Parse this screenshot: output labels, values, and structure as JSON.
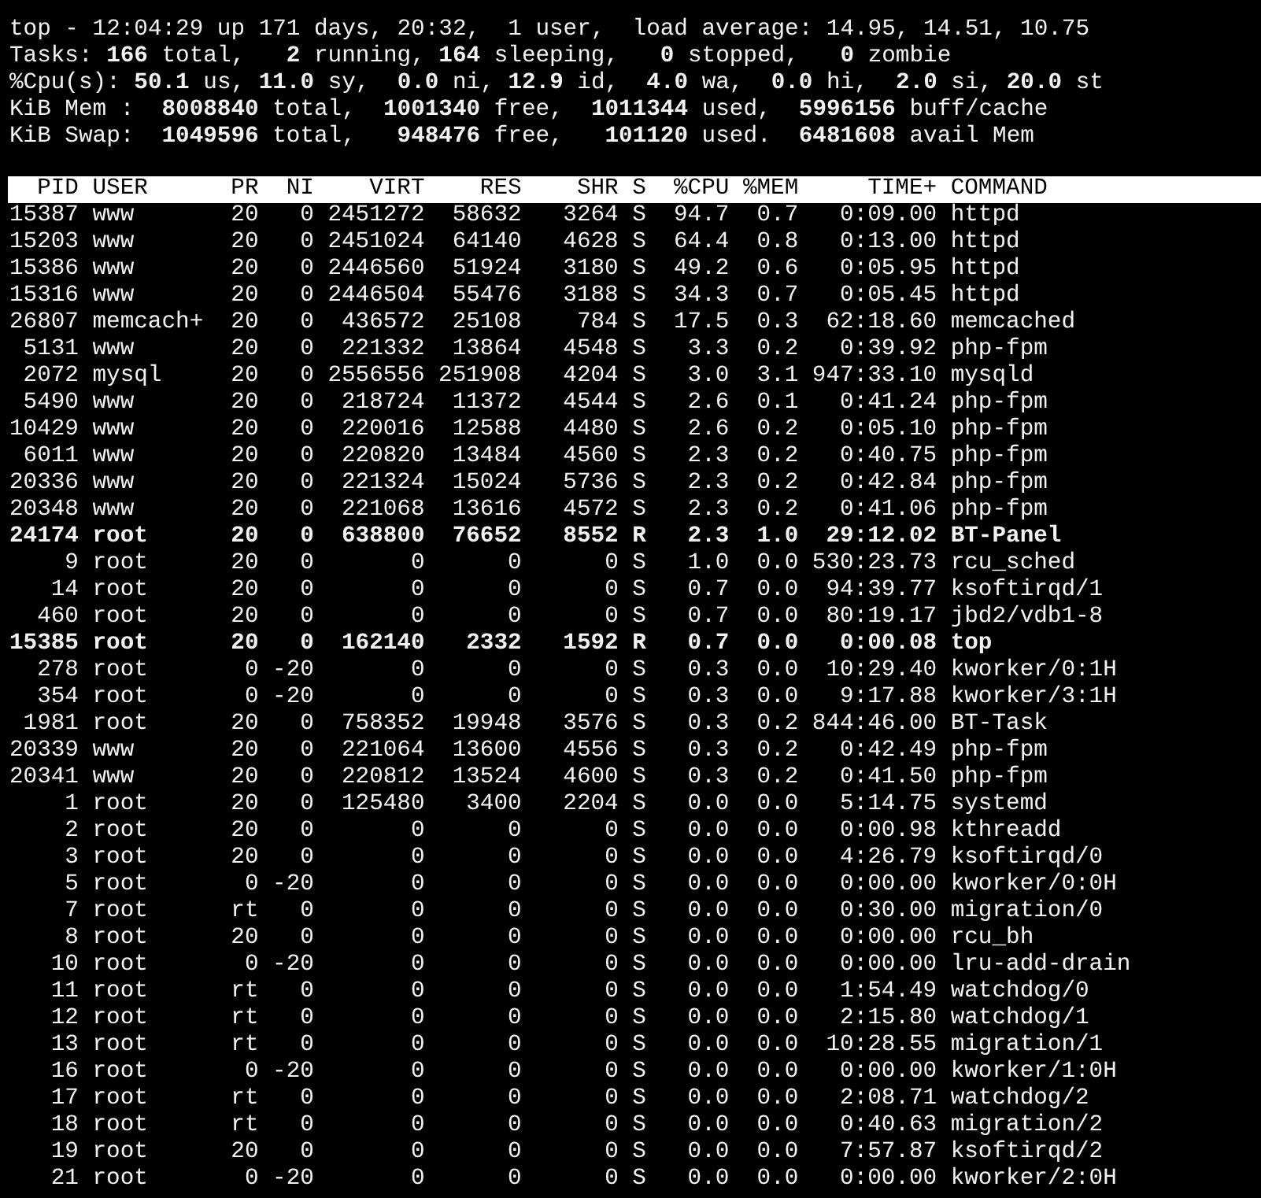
{
  "summary": [
    "top - 12:04:29 up 171 days, 20:32,  1 user,  load average: 14.95, 14.51, 10.75",
    "Tasks: **166** total,   **2** running, **164** sleeping,   **0** stopped,   **0** zombie",
    "%Cpu(s): **50.1** us, **11.0** sy,  **0.0** ni, **12.9** id,  **4.0** wa,  **0.0** hi,  **2.0** si, **20.0** st",
    "KiB Mem :  **8008840** total,  **1001340** free,  **1011344** used,  **5996156** buff/cache",
    "KiB Swap:  **1049596** total,   **948476** free,   **101120** used.  **6481608** avail Mem"
  ],
  "table": {
    "columns": [
      "PID",
      "USER",
      "PR",
      "NI",
      "VIRT",
      "RES",
      "SHR",
      "S",
      "%CPU",
      "%MEM",
      "TIME+",
      "COMMAND"
    ],
    "rows": [
      {
        "cells": [
          "15387",
          "www",
          "20",
          "0",
          "2451272",
          "58632",
          "3264",
          "S",
          "94.7",
          "0.7",
          "0:09.00",
          "httpd"
        ],
        "highlighted": false
      },
      {
        "cells": [
          "15203",
          "www",
          "20",
          "0",
          "2451024",
          "64140",
          "4628",
          "S",
          "64.4",
          "0.8",
          "0:13.00",
          "httpd"
        ],
        "highlighted": false
      },
      {
        "cells": [
          "15386",
          "www",
          "20",
          "0",
          "2446560",
          "51924",
          "3180",
          "S",
          "49.2",
          "0.6",
          "0:05.95",
          "httpd"
        ],
        "highlighted": false
      },
      {
        "cells": [
          "15316",
          "www",
          "20",
          "0",
          "2446504",
          "55476",
          "3188",
          "S",
          "34.3",
          "0.7",
          "0:05.45",
          "httpd"
        ],
        "highlighted": false
      },
      {
        "cells": [
          "26807",
          "memcach+",
          "20",
          "0",
          "436572",
          "25108",
          "784",
          "S",
          "17.5",
          "0.3",
          "62:18.60",
          "memcached"
        ],
        "highlighted": false
      },
      {
        "cells": [
          "5131",
          "www",
          "20",
          "0",
          "221332",
          "13864",
          "4548",
          "S",
          "3.3",
          "0.2",
          "0:39.92",
          "php-fpm"
        ],
        "highlighted": false
      },
      {
        "cells": [
          "2072",
          "mysql",
          "20",
          "0",
          "2556556",
          "251908",
          "4204",
          "S",
          "3.0",
          "3.1",
          "947:33.10",
          "mysqld"
        ],
        "highlighted": false
      },
      {
        "cells": [
          "5490",
          "www",
          "20",
          "0",
          "218724",
          "11372",
          "4544",
          "S",
          "2.6",
          "0.1",
          "0:41.24",
          "php-fpm"
        ],
        "highlighted": false
      },
      {
        "cells": [
          "10429",
          "www",
          "20",
          "0",
          "220016",
          "12588",
          "4480",
          "S",
          "2.6",
          "0.2",
          "0:05.10",
          "php-fpm"
        ],
        "highlighted": false
      },
      {
        "cells": [
          "6011",
          "www",
          "20",
          "0",
          "220820",
          "13484",
          "4560",
          "S",
          "2.3",
          "0.2",
          "0:40.75",
          "php-fpm"
        ],
        "highlighted": false
      },
      {
        "cells": [
          "20336",
          "www",
          "20",
          "0",
          "221324",
          "15024",
          "5736",
          "S",
          "2.3",
          "0.2",
          "0:42.84",
          "php-fpm"
        ],
        "highlighted": false
      },
      {
        "cells": [
          "20348",
          "www",
          "20",
          "0",
          "221068",
          "13616",
          "4572",
          "S",
          "2.3",
          "0.2",
          "0:41.06",
          "php-fpm"
        ],
        "highlighted": false
      },
      {
        "cells": [
          "24174",
          "root",
          "20",
          "0",
          "638800",
          "76652",
          "8552",
          "R",
          "2.3",
          "1.0",
          "29:12.02",
          "BT-Panel"
        ],
        "highlighted": true
      },
      {
        "cells": [
          "9",
          "root",
          "20",
          "0",
          "0",
          "0",
          "0",
          "S",
          "1.0",
          "0.0",
          "530:23.73",
          "rcu_sched"
        ],
        "highlighted": false
      },
      {
        "cells": [
          "14",
          "root",
          "20",
          "0",
          "0",
          "0",
          "0",
          "S",
          "0.7",
          "0.0",
          "94:39.77",
          "ksoftirqd/1"
        ],
        "highlighted": false
      },
      {
        "cells": [
          "460",
          "root",
          "20",
          "0",
          "0",
          "0",
          "0",
          "S",
          "0.7",
          "0.0",
          "80:19.17",
          "jbd2/vdb1-8"
        ],
        "highlighted": false
      },
      {
        "cells": [
          "15385",
          "root",
          "20",
          "0",
          "162140",
          "2332",
          "1592",
          "R",
          "0.7",
          "0.0",
          "0:00.08",
          "top"
        ],
        "highlighted": true
      },
      {
        "cells": [
          "278",
          "root",
          "0",
          "-20",
          "0",
          "0",
          "0",
          "S",
          "0.3",
          "0.0",
          "10:29.40",
          "kworker/0:1H"
        ],
        "highlighted": false
      },
      {
        "cells": [
          "354",
          "root",
          "0",
          "-20",
          "0",
          "0",
          "0",
          "S",
          "0.3",
          "0.0",
          "9:17.88",
          "kworker/3:1H"
        ],
        "highlighted": false
      },
      {
        "cells": [
          "1981",
          "root",
          "20",
          "0",
          "758352",
          "19948",
          "3576",
          "S",
          "0.3",
          "0.2",
          "844:46.00",
          "BT-Task"
        ],
        "highlighted": false
      },
      {
        "cells": [
          "20339",
          "www",
          "20",
          "0",
          "221064",
          "13600",
          "4556",
          "S",
          "0.3",
          "0.2",
          "0:42.49",
          "php-fpm"
        ],
        "highlighted": false
      },
      {
        "cells": [
          "20341",
          "www",
          "20",
          "0",
          "220812",
          "13524",
          "4600",
          "S",
          "0.3",
          "0.2",
          "0:41.50",
          "php-fpm"
        ],
        "highlighted": false
      },
      {
        "cells": [
          "1",
          "root",
          "20",
          "0",
          "125480",
          "3400",
          "2204",
          "S",
          "0.0",
          "0.0",
          "5:14.75",
          "systemd"
        ],
        "highlighted": false
      },
      {
        "cells": [
          "2",
          "root",
          "20",
          "0",
          "0",
          "0",
          "0",
          "S",
          "0.0",
          "0.0",
          "0:00.98",
          "kthreadd"
        ],
        "highlighted": false
      },
      {
        "cells": [
          "3",
          "root",
          "20",
          "0",
          "0",
          "0",
          "0",
          "S",
          "0.0",
          "0.0",
          "4:26.79",
          "ksoftirqd/0"
        ],
        "highlighted": false
      },
      {
        "cells": [
          "5",
          "root",
          "0",
          "-20",
          "0",
          "0",
          "0",
          "S",
          "0.0",
          "0.0",
          "0:00.00",
          "kworker/0:0H"
        ],
        "highlighted": false
      },
      {
        "cells": [
          "7",
          "root",
          "rt",
          "0",
          "0",
          "0",
          "0",
          "S",
          "0.0",
          "0.0",
          "0:30.00",
          "migration/0"
        ],
        "highlighted": false
      },
      {
        "cells": [
          "8",
          "root",
          "20",
          "0",
          "0",
          "0",
          "0",
          "S",
          "0.0",
          "0.0",
          "0:00.00",
          "rcu_bh"
        ],
        "highlighted": false
      },
      {
        "cells": [
          "10",
          "root",
          "0",
          "-20",
          "0",
          "0",
          "0",
          "S",
          "0.0",
          "0.0",
          "0:00.00",
          "lru-add-drain"
        ],
        "highlighted": false
      },
      {
        "cells": [
          "11",
          "root",
          "rt",
          "0",
          "0",
          "0",
          "0",
          "S",
          "0.0",
          "0.0",
          "1:54.49",
          "watchdog/0"
        ],
        "highlighted": false
      },
      {
        "cells": [
          "12",
          "root",
          "rt",
          "0",
          "0",
          "0",
          "0",
          "S",
          "0.0",
          "0.0",
          "2:15.80",
          "watchdog/1"
        ],
        "highlighted": false
      },
      {
        "cells": [
          "13",
          "root",
          "rt",
          "0",
          "0",
          "0",
          "0",
          "S",
          "0.0",
          "0.0",
          "10:28.55",
          "migration/1"
        ],
        "highlighted": false
      },
      {
        "cells": [
          "16",
          "root",
          "0",
          "-20",
          "0",
          "0",
          "0",
          "S",
          "0.0",
          "0.0",
          "0:00.00",
          "kworker/1:0H"
        ],
        "highlighted": false
      },
      {
        "cells": [
          "17",
          "root",
          "rt",
          "0",
          "0",
          "0",
          "0",
          "S",
          "0.0",
          "0.0",
          "2:08.71",
          "watchdog/2"
        ],
        "highlighted": false
      },
      {
        "cells": [
          "18",
          "root",
          "rt",
          "0",
          "0",
          "0",
          "0",
          "S",
          "0.0",
          "0.0",
          "0:40.63",
          "migration/2"
        ],
        "highlighted": false
      },
      {
        "cells": [
          "19",
          "root",
          "20",
          "0",
          "0",
          "0",
          "0",
          "S",
          "0.0",
          "0.0",
          "7:57.87",
          "ksoftirqd/2"
        ],
        "highlighted": false
      },
      {
        "cells": [
          "21",
          "root",
          "0",
          "-20",
          "0",
          "0",
          "0",
          "S",
          "0.0",
          "0.0",
          "0:00.00",
          "kworker/2:0H"
        ],
        "highlighted": false
      }
    ]
  }
}
